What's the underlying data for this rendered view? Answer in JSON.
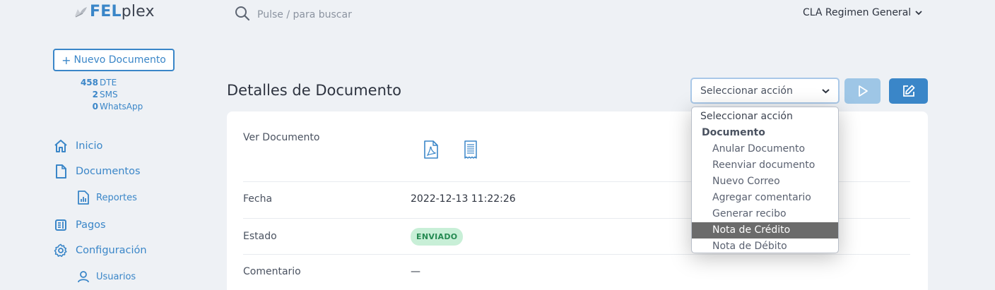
{
  "brand": {
    "fel": "FEL",
    "plex": "plex"
  },
  "search": {
    "placeholder": "Pulse / para buscar"
  },
  "company": {
    "name": "CLA Regimen General"
  },
  "sidebar": {
    "new_document": "Nuevo Documento",
    "counters": [
      {
        "num": "458",
        "label": "DTE"
      },
      {
        "num": "2",
        "label": "SMS"
      },
      {
        "num": "0",
        "label": "WhatsApp"
      }
    ],
    "nav": {
      "inicio": "Inicio",
      "documentos": "Documentos",
      "reportes": "Reportes",
      "pagos": "Pagos",
      "configuracion": "Configuración",
      "usuarios": "Usuarios"
    }
  },
  "page": {
    "title": "Detalles de Documento"
  },
  "actions": {
    "select_value": "Seleccionar acción",
    "dropdown": {
      "top": "Seleccionar acción",
      "group": "Documento",
      "options": [
        "Anular Documento",
        "Reenviar documento",
        "Nuevo Correo",
        "Agregar comentario",
        "Generar recibo",
        "Nota de Crédito",
        "Nota de Débito"
      ],
      "selected": "Nota de Crédito"
    }
  },
  "details": {
    "ver_documento": "Ver Documento",
    "fecha_label": "Fecha",
    "fecha_value": "2022-12-13 11:22:26",
    "estado_label": "Estado",
    "estado_value": "ENVIADO",
    "comentario_label": "Comentario",
    "comentario_value": "—"
  },
  "colors": {
    "primary": "#3a86c8",
    "primary_light": "#9ec6e6",
    "badge_bg": "#c8efd7",
    "badge_text": "#258a52"
  }
}
